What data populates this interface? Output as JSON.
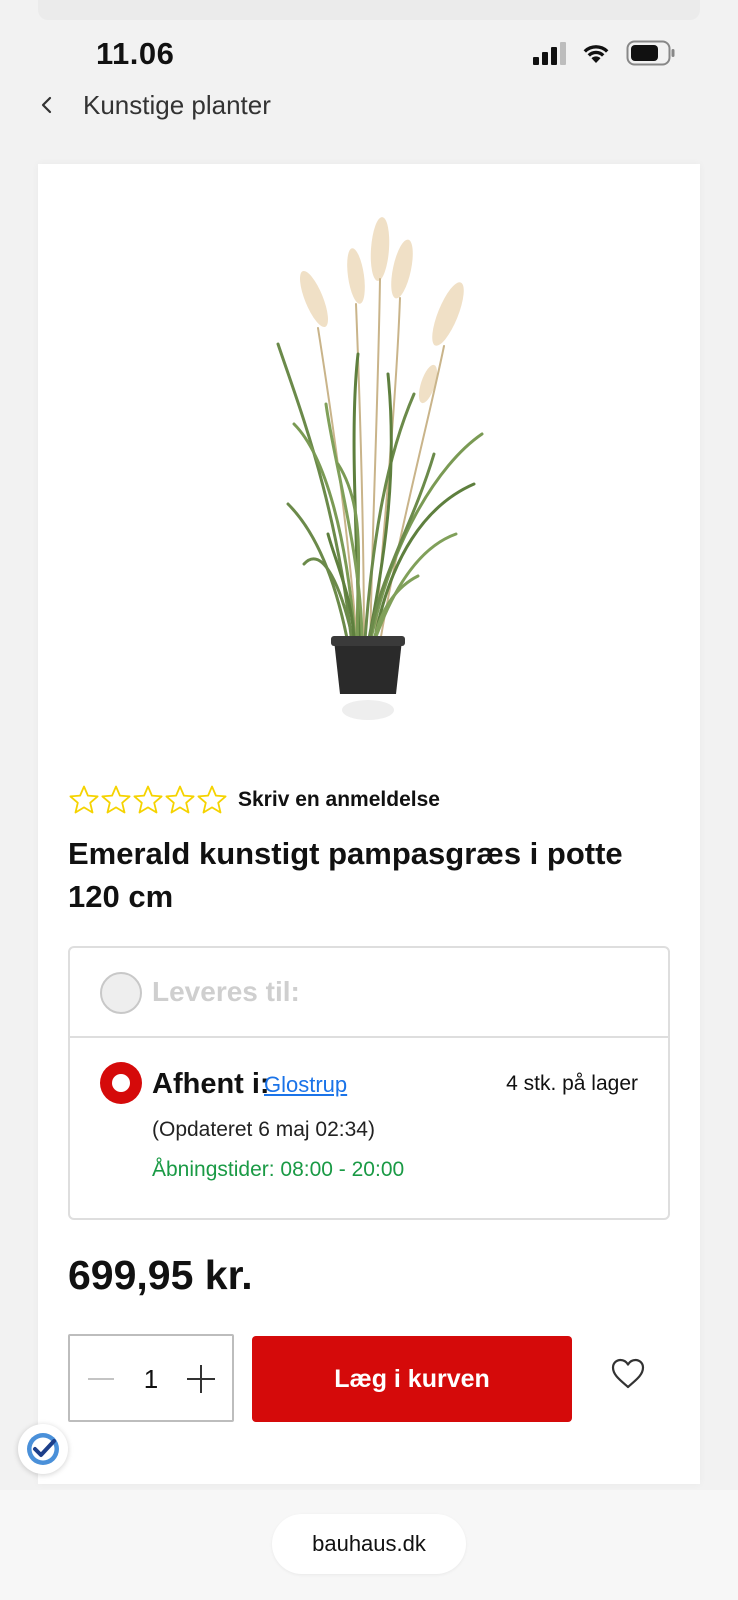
{
  "status_bar": {
    "time": "11.06",
    "icons": [
      "cellular-signal-icon",
      "wifi-icon",
      "battery-icon"
    ]
  },
  "nav": {
    "back_icon": "chevron-left-icon",
    "title": "Kunstige planter"
  },
  "product": {
    "image_icon": "pampas-grass-plant-image",
    "rating": {
      "stars_filled": 0,
      "stars_total": 5,
      "review_link": "Skriv en anmeldelse"
    },
    "title": "Emerald kunstigt pampasgræs i potte 120 cm",
    "price": "699,95 kr."
  },
  "delivery": {
    "ship_option": {
      "label": "Leveres til:",
      "selected": false
    },
    "pickup_option": {
      "label": "Afhent i:",
      "store": "Glostrup",
      "stock": "4 stk. på lager",
      "updated": "(Opdateret 6 maj 02:34)",
      "hours": "Åbningstider: 08:00 - 20:00",
      "selected": true
    }
  },
  "purchase": {
    "quantity": "1",
    "add_to_cart": "Læg i kurven",
    "wishlist_icon": "heart-icon"
  },
  "browser": {
    "url": "bauhaus.dk"
  },
  "colors": {
    "brand_red": "#d50a0a",
    "link_blue": "#1a73e8",
    "hours_green": "#1a9a45",
    "star_yellow": "#f5d300"
  }
}
